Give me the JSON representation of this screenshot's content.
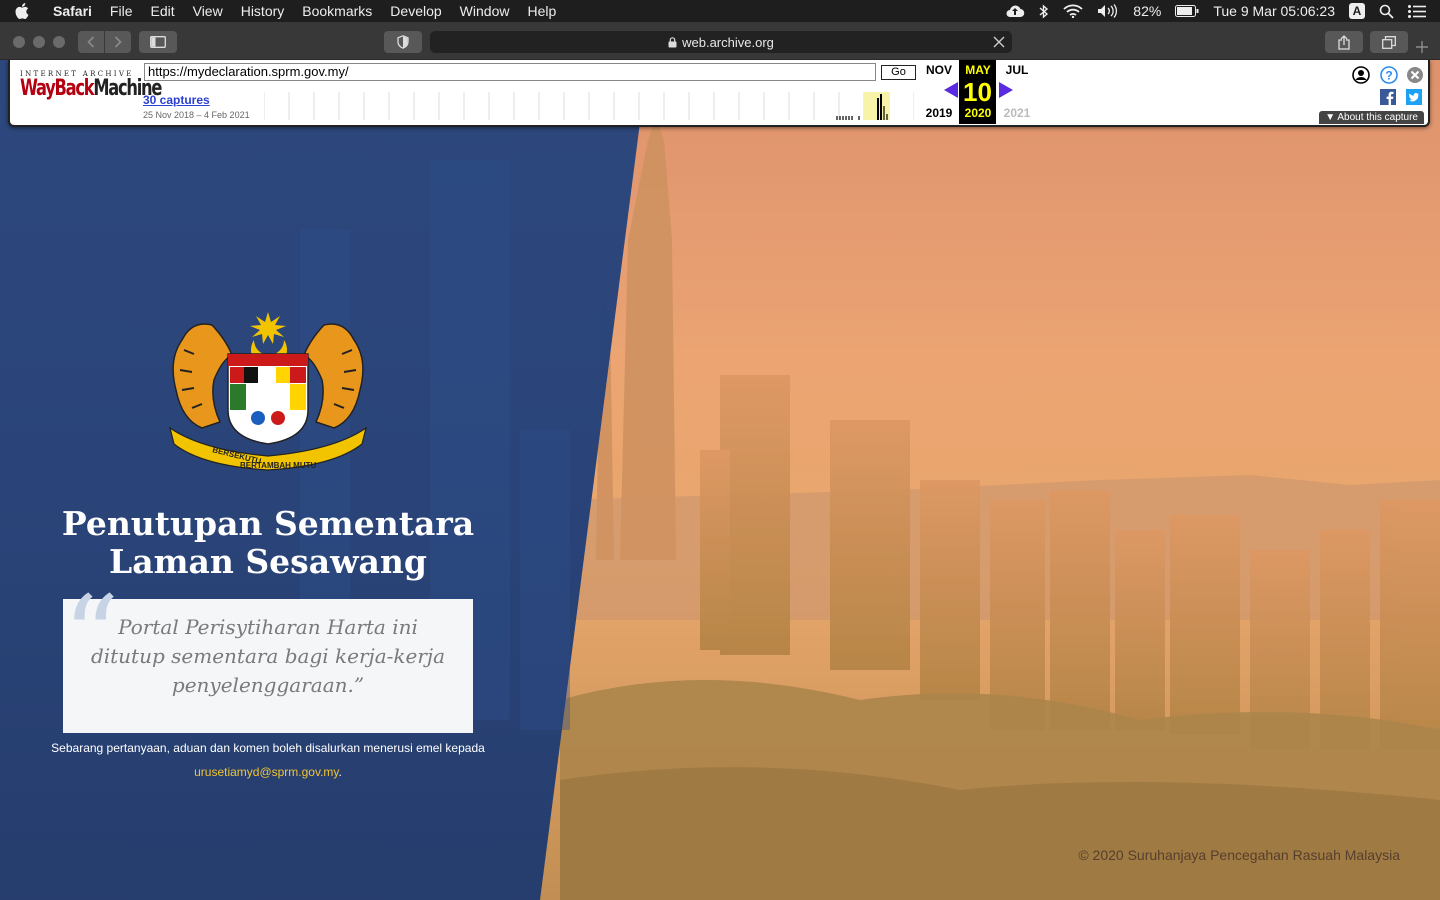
{
  "menubar": {
    "app_name": "Safari",
    "menus": [
      "File",
      "Edit",
      "View",
      "History",
      "Bookmarks",
      "Develop",
      "Window",
      "Help"
    ],
    "battery": "82%",
    "datetime": "Tue 9 Mar  05:06:23",
    "input_source": "A"
  },
  "browser": {
    "address": "web.archive.org"
  },
  "wayback": {
    "logo_top": "INTERNET ARCHIVE",
    "logo_main_a": "WayBack",
    "logo_main_b": "Machine",
    "url": "https://mydeclaration.sprm.gov.my/",
    "go_label": "Go",
    "captures": "30 captures",
    "range": "25 Nov 2018 – 4 Feb 2021",
    "months": {
      "prev": "NOV",
      "cur": "MAY",
      "next": "JUL"
    },
    "day": "10",
    "years": {
      "prev": "2019",
      "cur": "2020",
      "next": "2021"
    },
    "about": "About this capture"
  },
  "page": {
    "title_line1": "Penutupan Sementara",
    "title_line2": "Laman Sesawang",
    "quote": "Portal Perisytiharan Harta ini ditutup sementara bagi kerja-kerja penyelenggaraan.”",
    "contact_prefix": "Sebarang pertanyaan, aduan dan komen boleh disalurkan menerusi emel kepada ",
    "contact_email": "urusetiamyd@sprm.gov.my",
    "contact_suffix": ".",
    "footer": "© 2020 Suruhanjaya Pencegahan Rasuah Malaysia",
    "crest_ribbon_left": "BERSEKUTU",
    "crest_ribbon_bottom": "BERTAMBAH MUTU"
  }
}
